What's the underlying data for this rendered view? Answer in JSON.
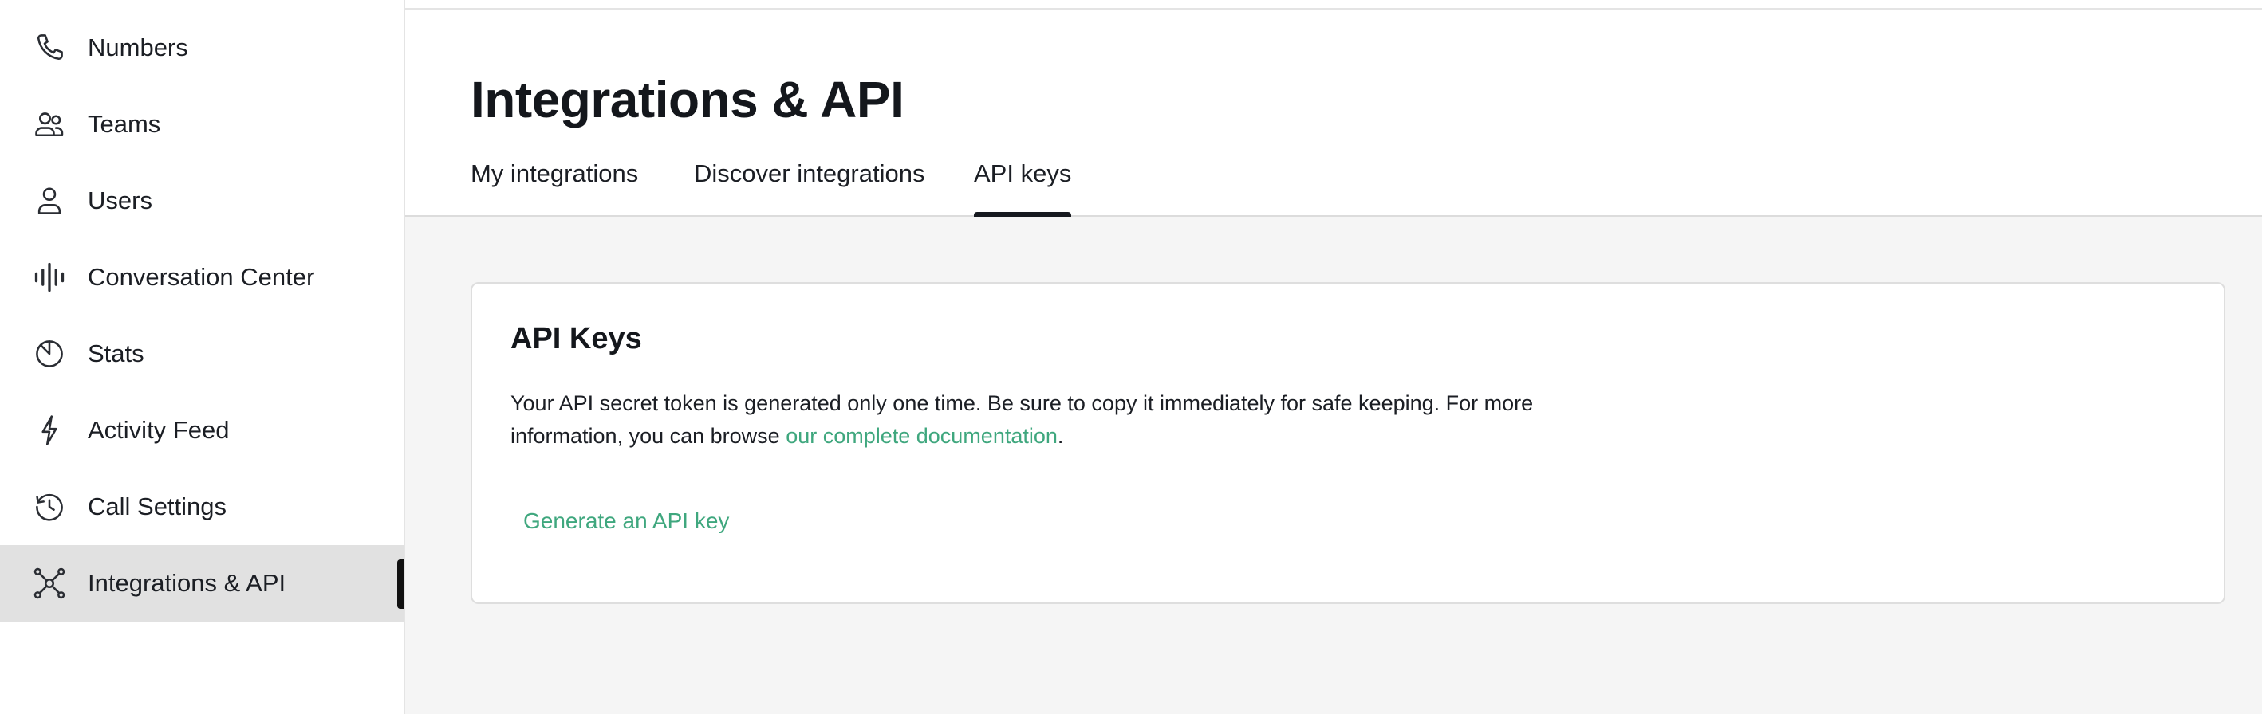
{
  "sidebar": {
    "items": [
      {
        "label": "Numbers",
        "icon": "phone-icon",
        "active": false
      },
      {
        "label": "Teams",
        "icon": "team-icon",
        "active": false
      },
      {
        "label": "Users",
        "icon": "user-icon",
        "active": false
      },
      {
        "label": "Conversation Center",
        "icon": "waveform-icon",
        "active": false
      },
      {
        "label": "Stats",
        "icon": "pie-chart-icon",
        "active": false
      },
      {
        "label": "Activity Feed",
        "icon": "lightning-icon",
        "active": false
      },
      {
        "label": "Call Settings",
        "icon": "history-icon",
        "active": false
      },
      {
        "label": "Integrations & API",
        "icon": "network-icon",
        "active": true
      }
    ]
  },
  "header": {
    "title": "Integrations & API",
    "tabs": [
      {
        "label": "My integrations",
        "active": false
      },
      {
        "label": "Discover integrations",
        "active": false
      },
      {
        "label": "API keys",
        "active": true
      }
    ]
  },
  "card": {
    "title": "API Keys",
    "description_before": "Your API secret token is generated only one time. Be sure to copy it immediately for safe keeping. For more information, you can browse ",
    "doc_link": "our complete documentation",
    "description_after": ".",
    "generate_label": "Generate an API key"
  },
  "colors": {
    "accent": "#3fa77e",
    "active_bg": "#e1e1e1",
    "content_bg": "#f5f5f5",
    "text": "#1b1e24"
  }
}
